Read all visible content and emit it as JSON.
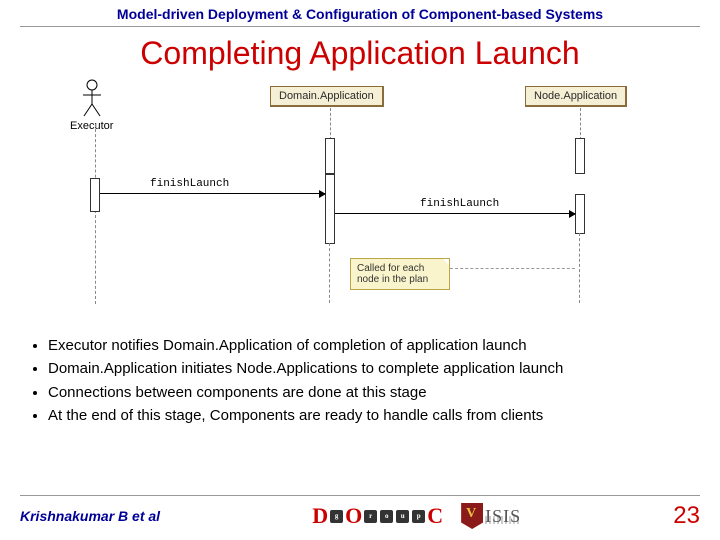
{
  "header": "Model-driven Deployment & Configuration of Component-based Systems",
  "title": "Completing Application Launch",
  "diagram": {
    "actor_label": "Executor",
    "object1": "Domain.Application",
    "object2": "Node.Application",
    "msg1": "finishLaunch",
    "msg2": "finishLaunch",
    "note": "Called for each node in the plan"
  },
  "bullets": [
    "Executor notifies Domain.Application of completion of application launch",
    "Domain.Application initiates Node.Applications to complete application launch",
    "Connections between components are done at this stage",
    "At the end of this stage, Components are ready to handle calls from clients"
  ],
  "footer": {
    "author": "Krishnakumar B et al",
    "logo_doc_letters": [
      "D",
      "O",
      "C"
    ],
    "logo_doc_dots": [
      "g",
      "r",
      "o",
      "u",
      "p"
    ],
    "logo_isis_text": "ISIS",
    "page": "23"
  }
}
